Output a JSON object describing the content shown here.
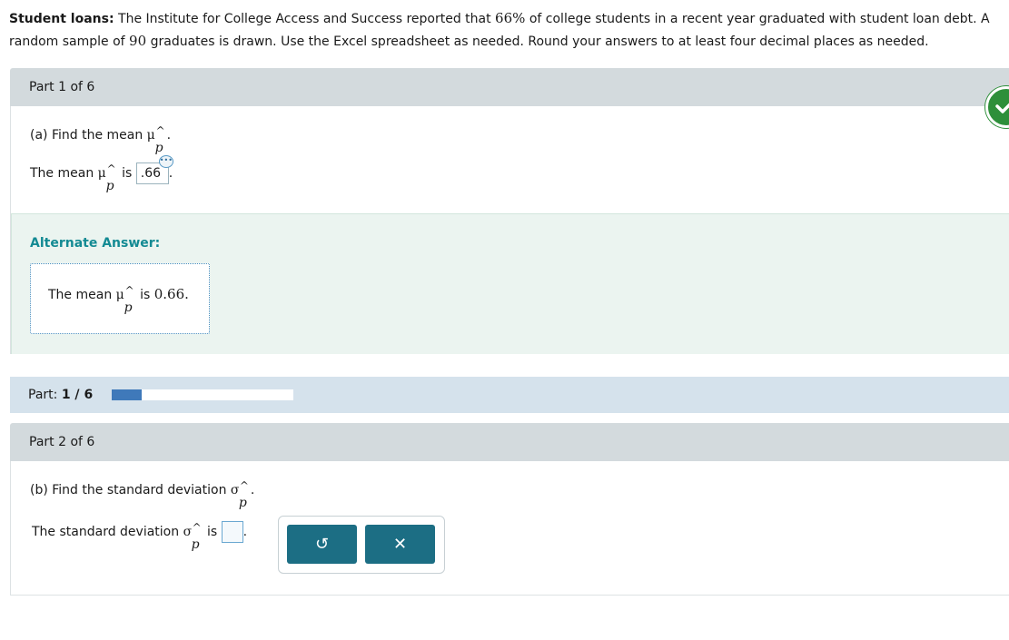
{
  "intro": {
    "bold": "Student loans:",
    "text_before_pct": " The Institute for College Access and Success reported that ",
    "pct": "66%",
    "text_mid": " of college students in a recent year graduated with student loan debt. A random sample of ",
    "n": "90",
    "text_after": " graduates is drawn. Use the Excel spreadsheet as needed. Round your answers to at least four decimal places as needed."
  },
  "part1": {
    "header": "Part 1 of 6",
    "question_prefix": "(a) Find the mean ",
    "symbol": "μ",
    "hat": "^",
    "sub": "p",
    "question_suffix": ".",
    "answer_prefix": "The mean ",
    "answer_is": " is ",
    "answer_value": ".66",
    "answer_suffix": ".",
    "dots": "•••",
    "alt_title": "Alternate Answer:",
    "alt_prefix": "The mean ",
    "alt_is": " is ",
    "alt_value": "0.66."
  },
  "progress": {
    "label": "Part: ",
    "current": "1",
    "sep": " / ",
    "total": "6",
    "fraction": 0.1667
  },
  "part2": {
    "header": "Part 2 of 6",
    "question_prefix": "(b) Find the standard deviation ",
    "symbol": "σ",
    "hat": "^",
    "sub": "p",
    "question_suffix": ".",
    "answer_prefix": "The standard deviation ",
    "answer_is": " is ",
    "answer_suffix": ".",
    "reset_icon": "↺",
    "clear_icon": "✕"
  },
  "colors": {
    "header_bg": "#d3dadd",
    "alt_bg": "#ebf4f0",
    "alt_title": "#138a93",
    "progress_bg": "#d5e2ec",
    "progress_fill": "#3f79ba",
    "button": "#1c6e84",
    "check": "#2e8f3a"
  }
}
